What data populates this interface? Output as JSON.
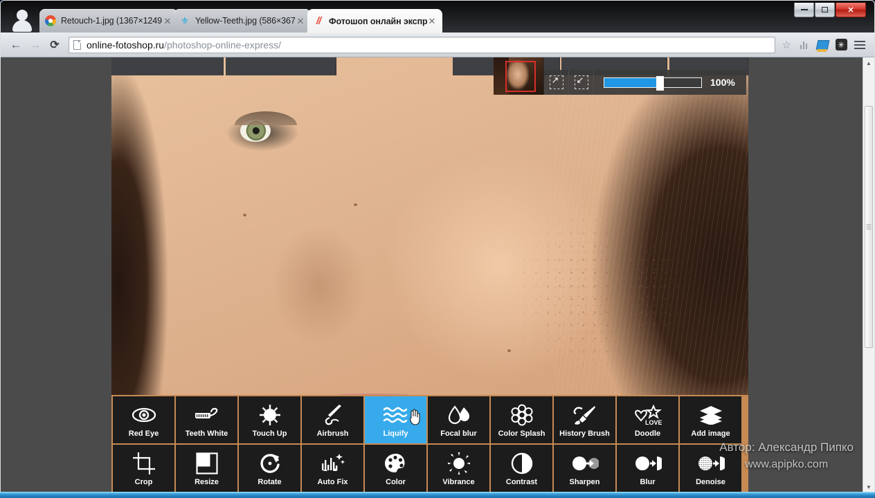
{
  "window": {
    "controls": [
      {
        "name": "minimize",
        "label": "—"
      },
      {
        "name": "maximize",
        "label": "❐"
      },
      {
        "name": "close",
        "label": "✕"
      }
    ]
  },
  "browser": {
    "tabs": [
      {
        "title": "Retouch-1.jpg (1367×1249",
        "favicon": "picasa-icon",
        "active": false,
        "close": "✕"
      },
      {
        "title": "Yellow-Teeth.jpg (586×367",
        "favicon": "butterfly-icon",
        "active": false,
        "close": "✕"
      },
      {
        "title": "Фотошоп онлайн экспре",
        "favicon": "pixlr-icon",
        "active": true,
        "close": "✕"
      }
    ],
    "nav": {
      "back": "←",
      "forward": "→",
      "reload": "⟳",
      "url_domain": "online-fotoshop.ru",
      "url_path": "/photoshop-online-express/",
      "bookmark": "☆",
      "menu": "≡"
    },
    "extensions": [
      {
        "name": "analytics-extension-icon"
      },
      {
        "name": "bluebook-extension-icon"
      },
      {
        "name": "asterisk-extension-icon"
      }
    ]
  },
  "editor": {
    "navigator": {
      "viewport_color": "#d82f2a"
    },
    "zoom": {
      "expand_label": "↗",
      "shrink_label": "↙",
      "value": "100%",
      "fill_percent": 57,
      "accent": "#2196e3"
    },
    "selected_tool": "Liquify",
    "selected_color": "#36aaea",
    "palette_bg": "#c68a52",
    "tool_rows": [
      [
        {
          "label": "Red Eye",
          "icon": "eye-icon",
          "glyph": "◉",
          "selected": false
        },
        {
          "label": "Teeth White",
          "icon": "toothbrush-icon",
          "glyph": "🪥",
          "selected": false
        },
        {
          "label": "Touch Up",
          "icon": "touchup-icon",
          "glyph": "✴",
          "selected": false
        },
        {
          "label": "Airbrush",
          "icon": "airbrush-icon",
          "glyph": "✎",
          "selected": false
        },
        {
          "label": "Liquify",
          "icon": "waves-icon",
          "glyph": "≋",
          "selected": true
        },
        {
          "label": "Focal blur",
          "icon": "droplets-icon",
          "glyph": "💧",
          "selected": false
        },
        {
          "label": "Color Splash",
          "icon": "flower-icon",
          "glyph": "✿",
          "selected": false
        },
        {
          "label": "History Brush",
          "icon": "paintbrush-icon",
          "glyph": "🖌",
          "selected": false
        },
        {
          "label": "Doodle",
          "icon": "doodle-love-icon",
          "glyph": "♡",
          "selected": false
        },
        {
          "label": "Add image",
          "icon": "layers-icon",
          "glyph": "▤",
          "selected": false
        }
      ],
      [
        {
          "label": "Crop",
          "icon": "crop-icon",
          "glyph": "⌗",
          "selected": false
        },
        {
          "label": "Resize",
          "icon": "resize-icon",
          "glyph": "◱",
          "selected": false
        },
        {
          "label": "Rotate",
          "icon": "rotate-icon",
          "glyph": "↻",
          "selected": false
        },
        {
          "label": "Auto Fix",
          "icon": "autofix-icon",
          "glyph": "📊",
          "selected": false
        },
        {
          "label": "Color",
          "icon": "palette-icon",
          "glyph": "🎨",
          "selected": false
        },
        {
          "label": "Vibrance",
          "icon": "sun-icon",
          "glyph": "☀",
          "selected": false
        },
        {
          "label": "Contrast",
          "icon": "contrast-icon",
          "glyph": "◐",
          "selected": false
        },
        {
          "label": "Sharpen",
          "icon": "sharpen-icon",
          "glyph": "◕",
          "selected": false
        },
        {
          "label": "Blur",
          "icon": "blur-icon",
          "glyph": "◑",
          "selected": false
        },
        {
          "label": "Denoise",
          "icon": "denoise-icon",
          "glyph": "◓",
          "selected": false
        }
      ]
    ]
  },
  "watermark": {
    "line1": "Автор: Александр Пипко",
    "line2": "www.apipko.com"
  }
}
